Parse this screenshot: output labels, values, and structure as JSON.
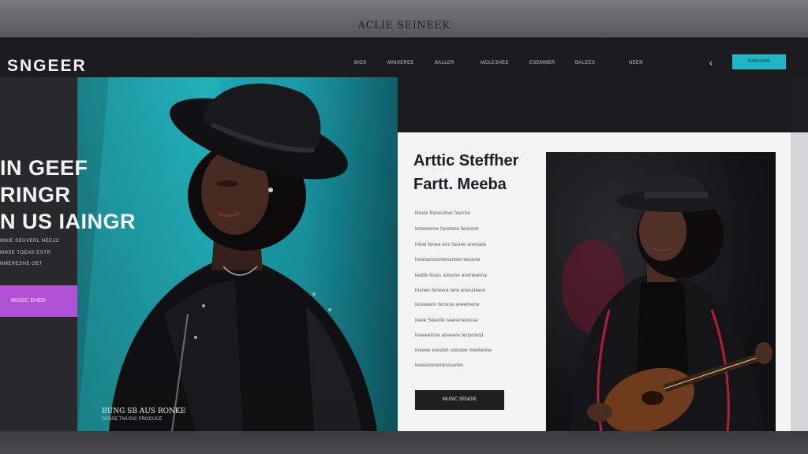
{
  "window": {
    "title": "ACLIE SEINEEK"
  },
  "nav": {
    "brand": "SNGEER",
    "links": [
      "BIOS",
      "MINSEREE",
      "BALLER",
      "MOLESHEE",
      "ESEMMER",
      "BALEES",
      "NEEN"
    ],
    "cta_label": "SUBSCRIBE",
    "back_icon": "chevron-left-icon"
  },
  "hero": {
    "headline": [
      "IN GEEF",
      "RINGR",
      "N US IAINGR"
    ],
    "sub_lines": [
      "MNIE SEUVERL NEELD",
      "MNSE TOEAS ESTR",
      "NMERESNE OET"
    ],
    "button_label": "MUSIC EHER",
    "caption_title": "BUNG SB AUS RONKE",
    "caption_sub": "SENSE TMUSIC PRODUCE"
  },
  "card": {
    "title_line1": "Arttic Steffher",
    "title_line2": "Fartt. Meeba",
    "lines": [
      "Neste frenesitive fournte",
      "Ietteemme faretteta faresimt",
      "Irfeel fenee erin fannie emmaile",
      "Inneserssonfessnnerreesone",
      "Ieatte foses sessme aneneanna",
      "Insnee feneere tere enessteere",
      "Iesweann ferrene aneetnene",
      "Ieete Steesfe seeremetesse",
      "Ineeeemne aneeere terperend",
      "Ineeee eresteh stessee meeteene",
      "Ineeemetemesoseine"
    ],
    "button_label": "MUSIC SENDIE"
  },
  "colors": {
    "accent_cyan": "#1fb6c8",
    "accent_purple": "#b351d6",
    "background": "#1c1c1f"
  }
}
